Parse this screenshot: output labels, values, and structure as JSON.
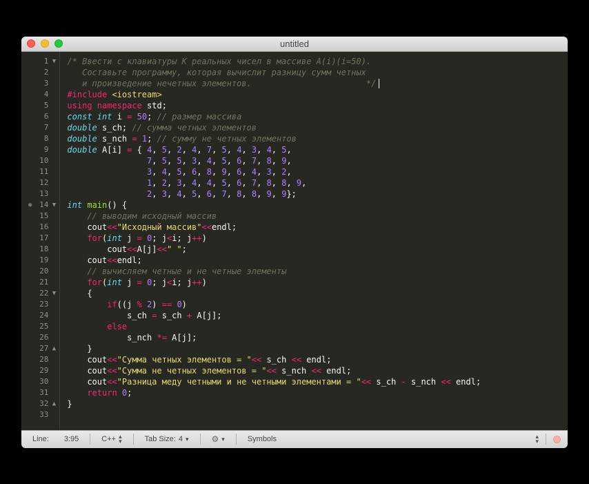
{
  "window": {
    "title": "untitled"
  },
  "status": {
    "line_label": "Line:",
    "line_value": "3:95",
    "language": "C++",
    "tabsize_label": "Tab Size:",
    "tabsize_value": "4",
    "symbols": "Symbols"
  },
  "gutter": [
    {
      "n": "1",
      "mark": "▼"
    },
    {
      "n": "2",
      "mark": ""
    },
    {
      "n": "3",
      "mark": ""
    },
    {
      "n": "4",
      "mark": ""
    },
    {
      "n": "5",
      "mark": ""
    },
    {
      "n": "6",
      "mark": ""
    },
    {
      "n": "7",
      "mark": ""
    },
    {
      "n": "8",
      "mark": ""
    },
    {
      "n": "9",
      "mark": ""
    },
    {
      "n": "10",
      "mark": ""
    },
    {
      "n": "11",
      "mark": ""
    },
    {
      "n": "12",
      "mark": ""
    },
    {
      "n": "13",
      "mark": ""
    },
    {
      "n": "14",
      "mark": "▼",
      "dot": true
    },
    {
      "n": "15",
      "mark": ""
    },
    {
      "n": "16",
      "mark": ""
    },
    {
      "n": "17",
      "mark": ""
    },
    {
      "n": "18",
      "mark": ""
    },
    {
      "n": "19",
      "mark": ""
    },
    {
      "n": "20",
      "mark": ""
    },
    {
      "n": "21",
      "mark": ""
    },
    {
      "n": "22",
      "mark": "▼"
    },
    {
      "n": "23",
      "mark": ""
    },
    {
      "n": "24",
      "mark": ""
    },
    {
      "n": "25",
      "mark": ""
    },
    {
      "n": "26",
      "mark": ""
    },
    {
      "n": "27",
      "mark": "▲"
    },
    {
      "n": "28",
      "mark": ""
    },
    {
      "n": "29",
      "mark": ""
    },
    {
      "n": "30",
      "mark": ""
    },
    {
      "n": "31",
      "mark": ""
    },
    {
      "n": "32",
      "mark": "▲"
    },
    {
      "n": "33",
      "mark": ""
    }
  ],
  "code": [
    [
      {
        "c": "c-comment",
        "t": "/* Ввести с клавиатуры K реальных чисел в массиве A(i)(i=50)."
      }
    ],
    [
      {
        "c": "c-comment",
        "t": "   Составьте программу, которая вычислит разницу сумм четных"
      }
    ],
    [
      {
        "c": "c-comment",
        "t": "   и произведение нечетных элементов.                       */"
      },
      {
        "cursor": true
      }
    ],
    [
      {
        "c": "c-include",
        "t": "#include "
      },
      {
        "c": "c-incfile",
        "t": "<iostream>"
      }
    ],
    [
      {
        "c": "c-keyword2",
        "t": "using"
      },
      {
        "t": " "
      },
      {
        "c": "c-keyword2",
        "t": "namespace"
      },
      {
        "t": " "
      },
      {
        "c": "c-ident",
        "t": "std"
      },
      {
        "c": "c-punct",
        "t": ";"
      }
    ],
    [
      {
        "c": "c-type",
        "t": "const"
      },
      {
        "t": " "
      },
      {
        "c": "c-type",
        "t": "int"
      },
      {
        "t": " "
      },
      {
        "c": "c-ident",
        "t": "i"
      },
      {
        "t": " "
      },
      {
        "c": "c-op",
        "t": "="
      },
      {
        "t": " "
      },
      {
        "c": "c-number",
        "t": "50"
      },
      {
        "c": "c-punct",
        "t": ";"
      },
      {
        "t": " "
      },
      {
        "c": "c-comment",
        "t": "// размер массива"
      }
    ],
    [
      {
        "c": "c-type",
        "t": "double"
      },
      {
        "t": " "
      },
      {
        "c": "c-ident",
        "t": "s_ch"
      },
      {
        "c": "c-punct",
        "t": ";"
      },
      {
        "t": " "
      },
      {
        "c": "c-comment",
        "t": "// сумма четных элементов"
      }
    ],
    [
      {
        "c": "c-type",
        "t": "double"
      },
      {
        "t": " "
      },
      {
        "c": "c-ident",
        "t": "s_nch"
      },
      {
        "t": " "
      },
      {
        "c": "c-op",
        "t": "="
      },
      {
        "t": " "
      },
      {
        "c": "c-number",
        "t": "1"
      },
      {
        "c": "c-punct",
        "t": ";"
      },
      {
        "t": " "
      },
      {
        "c": "c-comment",
        "t": "// сумму не четных элементов"
      }
    ],
    [
      {
        "c": "c-type",
        "t": "double"
      },
      {
        "t": " "
      },
      {
        "c": "c-ident",
        "t": "A"
      },
      {
        "c": "c-punct",
        "t": "["
      },
      {
        "c": "c-ident",
        "t": "i"
      },
      {
        "c": "c-punct",
        "t": "]"
      },
      {
        "t": " "
      },
      {
        "c": "c-op",
        "t": "="
      },
      {
        "t": " "
      },
      {
        "c": "c-punct",
        "t": "{ "
      },
      {
        "c": "c-number",
        "t": "4"
      },
      {
        "c": "c-punct",
        "t": ", "
      },
      {
        "c": "c-number",
        "t": "5"
      },
      {
        "c": "c-punct",
        "t": ", "
      },
      {
        "c": "c-number",
        "t": "2"
      },
      {
        "c": "c-punct",
        "t": ", "
      },
      {
        "c": "c-number",
        "t": "4"
      },
      {
        "c": "c-punct",
        "t": ", "
      },
      {
        "c": "c-number",
        "t": "7"
      },
      {
        "c": "c-punct",
        "t": ", "
      },
      {
        "c": "c-number",
        "t": "5"
      },
      {
        "c": "c-punct",
        "t": ", "
      },
      {
        "c": "c-number",
        "t": "4"
      },
      {
        "c": "c-punct",
        "t": ", "
      },
      {
        "c": "c-number",
        "t": "3"
      },
      {
        "c": "c-punct",
        "t": ", "
      },
      {
        "c": "c-number",
        "t": "4"
      },
      {
        "c": "c-punct",
        "t": ", "
      },
      {
        "c": "c-number",
        "t": "5"
      },
      {
        "c": "c-punct",
        "t": ","
      }
    ],
    [
      {
        "t": "                "
      },
      {
        "c": "c-number",
        "t": "7"
      },
      {
        "c": "c-punct",
        "t": ", "
      },
      {
        "c": "c-number",
        "t": "5"
      },
      {
        "c": "c-punct",
        "t": ", "
      },
      {
        "c": "c-number",
        "t": "5"
      },
      {
        "c": "c-punct",
        "t": ", "
      },
      {
        "c": "c-number",
        "t": "3"
      },
      {
        "c": "c-punct",
        "t": ", "
      },
      {
        "c": "c-number",
        "t": "4"
      },
      {
        "c": "c-punct",
        "t": ", "
      },
      {
        "c": "c-number",
        "t": "5"
      },
      {
        "c": "c-punct",
        "t": ", "
      },
      {
        "c": "c-number",
        "t": "6"
      },
      {
        "c": "c-punct",
        "t": ", "
      },
      {
        "c": "c-number",
        "t": "7"
      },
      {
        "c": "c-punct",
        "t": ", "
      },
      {
        "c": "c-number",
        "t": "8"
      },
      {
        "c": "c-punct",
        "t": ", "
      },
      {
        "c": "c-number",
        "t": "9"
      },
      {
        "c": "c-punct",
        "t": ","
      }
    ],
    [
      {
        "t": "                "
      },
      {
        "c": "c-number",
        "t": "3"
      },
      {
        "c": "c-punct",
        "t": ", "
      },
      {
        "c": "c-number",
        "t": "4"
      },
      {
        "c": "c-punct",
        "t": ", "
      },
      {
        "c": "c-number",
        "t": "5"
      },
      {
        "c": "c-punct",
        "t": ", "
      },
      {
        "c": "c-number",
        "t": "6"
      },
      {
        "c": "c-punct",
        "t": ", "
      },
      {
        "c": "c-number",
        "t": "8"
      },
      {
        "c": "c-punct",
        "t": ", "
      },
      {
        "c": "c-number",
        "t": "9"
      },
      {
        "c": "c-punct",
        "t": ", "
      },
      {
        "c": "c-number",
        "t": "6"
      },
      {
        "c": "c-punct",
        "t": ", "
      },
      {
        "c": "c-number",
        "t": "4"
      },
      {
        "c": "c-punct",
        "t": ", "
      },
      {
        "c": "c-number",
        "t": "3"
      },
      {
        "c": "c-punct",
        "t": ", "
      },
      {
        "c": "c-number",
        "t": "2"
      },
      {
        "c": "c-punct",
        "t": ","
      }
    ],
    [
      {
        "t": "                "
      },
      {
        "c": "c-number",
        "t": "1"
      },
      {
        "c": "c-punct",
        "t": ", "
      },
      {
        "c": "c-number",
        "t": "2"
      },
      {
        "c": "c-punct",
        "t": ", "
      },
      {
        "c": "c-number",
        "t": "3"
      },
      {
        "c": "c-punct",
        "t": ", "
      },
      {
        "c": "c-number",
        "t": "4"
      },
      {
        "c": "c-punct",
        "t": ", "
      },
      {
        "c": "c-number",
        "t": "4"
      },
      {
        "c": "c-punct",
        "t": ", "
      },
      {
        "c": "c-number",
        "t": "5"
      },
      {
        "c": "c-punct",
        "t": ", "
      },
      {
        "c": "c-number",
        "t": "6"
      },
      {
        "c": "c-punct",
        "t": ", "
      },
      {
        "c": "c-number",
        "t": "7"
      },
      {
        "c": "c-punct",
        "t": ", "
      },
      {
        "c": "c-number",
        "t": "8"
      },
      {
        "c": "c-punct",
        "t": ", "
      },
      {
        "c": "c-number",
        "t": "8"
      },
      {
        "c": "c-punct",
        "t": ", "
      },
      {
        "c": "c-number",
        "t": "9"
      },
      {
        "c": "c-punct",
        "t": ","
      }
    ],
    [
      {
        "t": "                "
      },
      {
        "c": "c-number",
        "t": "2"
      },
      {
        "c": "c-punct",
        "t": ", "
      },
      {
        "c": "c-number",
        "t": "3"
      },
      {
        "c": "c-punct",
        "t": ", "
      },
      {
        "c": "c-number",
        "t": "4"
      },
      {
        "c": "c-punct",
        "t": ", "
      },
      {
        "c": "c-number",
        "t": "5"
      },
      {
        "c": "c-punct",
        "t": ", "
      },
      {
        "c": "c-number",
        "t": "6"
      },
      {
        "c": "c-punct",
        "t": ", "
      },
      {
        "c": "c-number",
        "t": "7"
      },
      {
        "c": "c-punct",
        "t": ", "
      },
      {
        "c": "c-number",
        "t": "8"
      },
      {
        "c": "c-punct",
        "t": ", "
      },
      {
        "c": "c-number",
        "t": "8"
      },
      {
        "c": "c-punct",
        "t": ", "
      },
      {
        "c": "c-number",
        "t": "9"
      },
      {
        "c": "c-punct",
        "t": ", "
      },
      {
        "c": "c-number",
        "t": "9"
      },
      {
        "c": "c-punct",
        "t": "};"
      }
    ],
    [
      {
        "c": "c-type",
        "t": "int"
      },
      {
        "t": " "
      },
      {
        "c": "c-func",
        "t": "main"
      },
      {
        "c": "c-punct",
        "t": "() {"
      }
    ],
    [
      {
        "t": "    "
      },
      {
        "c": "c-comment",
        "t": "// выводим исходный массив"
      }
    ],
    [
      {
        "t": "    "
      },
      {
        "c": "c-ident",
        "t": "cout"
      },
      {
        "c": "c-op",
        "t": "<<"
      },
      {
        "c": "c-string",
        "t": "\"Исходный массив\""
      },
      {
        "c": "c-op",
        "t": "<<"
      },
      {
        "c": "c-ident",
        "t": "endl"
      },
      {
        "c": "c-punct",
        "t": ";"
      }
    ],
    [
      {
        "t": "    "
      },
      {
        "c": "c-keyword2",
        "t": "for"
      },
      {
        "c": "c-punct",
        "t": "("
      },
      {
        "c": "c-type",
        "t": "int"
      },
      {
        "t": " "
      },
      {
        "c": "c-ident",
        "t": "j"
      },
      {
        "t": " "
      },
      {
        "c": "c-op",
        "t": "="
      },
      {
        "t": " "
      },
      {
        "c": "c-number",
        "t": "0"
      },
      {
        "c": "c-punct",
        "t": "; "
      },
      {
        "c": "c-ident",
        "t": "j"
      },
      {
        "c": "c-op",
        "t": "<"
      },
      {
        "c": "c-ident",
        "t": "i"
      },
      {
        "c": "c-punct",
        "t": "; "
      },
      {
        "c": "c-ident",
        "t": "j"
      },
      {
        "c": "c-op",
        "t": "++"
      },
      {
        "c": "c-punct",
        "t": ")"
      }
    ],
    [
      {
        "t": "        "
      },
      {
        "c": "c-ident",
        "t": "cout"
      },
      {
        "c": "c-op",
        "t": "<<"
      },
      {
        "c": "c-ident",
        "t": "A"
      },
      {
        "c": "c-punct",
        "t": "["
      },
      {
        "c": "c-ident",
        "t": "j"
      },
      {
        "c": "c-punct",
        "t": "]"
      },
      {
        "c": "c-op",
        "t": "<<"
      },
      {
        "c": "c-string",
        "t": "\" \""
      },
      {
        "c": "c-punct",
        "t": ";"
      }
    ],
    [
      {
        "t": "    "
      },
      {
        "c": "c-ident",
        "t": "cout"
      },
      {
        "c": "c-op",
        "t": "<<"
      },
      {
        "c": "c-ident",
        "t": "endl"
      },
      {
        "c": "c-punct",
        "t": ";"
      }
    ],
    [
      {
        "t": "    "
      },
      {
        "c": "c-comment",
        "t": "// вычисляем четные и не четные элементы"
      }
    ],
    [
      {
        "t": "    "
      },
      {
        "c": "c-keyword2",
        "t": "for"
      },
      {
        "c": "c-punct",
        "t": "("
      },
      {
        "c": "c-type",
        "t": "int"
      },
      {
        "t": " "
      },
      {
        "c": "c-ident",
        "t": "j"
      },
      {
        "t": " "
      },
      {
        "c": "c-op",
        "t": "="
      },
      {
        "t": " "
      },
      {
        "c": "c-number",
        "t": "0"
      },
      {
        "c": "c-punct",
        "t": "; "
      },
      {
        "c": "c-ident",
        "t": "j"
      },
      {
        "c": "c-op",
        "t": "<"
      },
      {
        "c": "c-ident",
        "t": "i"
      },
      {
        "c": "c-punct",
        "t": "; "
      },
      {
        "c": "c-ident",
        "t": "j"
      },
      {
        "c": "c-op",
        "t": "++"
      },
      {
        "c": "c-punct",
        "t": ")"
      }
    ],
    [
      {
        "t": "    "
      },
      {
        "c": "c-punct",
        "t": "{"
      }
    ],
    [
      {
        "t": "        "
      },
      {
        "c": "c-keyword2",
        "t": "if"
      },
      {
        "c": "c-punct",
        "t": "(("
      },
      {
        "c": "c-ident",
        "t": "j"
      },
      {
        "t": " "
      },
      {
        "c": "c-op",
        "t": "%"
      },
      {
        "t": " "
      },
      {
        "c": "c-number",
        "t": "2"
      },
      {
        "c": "c-punct",
        "t": ") "
      },
      {
        "c": "c-op",
        "t": "=="
      },
      {
        "t": " "
      },
      {
        "c": "c-number",
        "t": "0"
      },
      {
        "c": "c-punct",
        "t": ")"
      }
    ],
    [
      {
        "t": "            "
      },
      {
        "c": "c-ident",
        "t": "s_ch"
      },
      {
        "t": " "
      },
      {
        "c": "c-op",
        "t": "="
      },
      {
        "t": " "
      },
      {
        "c": "c-ident",
        "t": "s_ch"
      },
      {
        "t": " "
      },
      {
        "c": "c-op",
        "t": "+"
      },
      {
        "t": " "
      },
      {
        "c": "c-ident",
        "t": "A"
      },
      {
        "c": "c-punct",
        "t": "["
      },
      {
        "c": "c-ident",
        "t": "j"
      },
      {
        "c": "c-punct",
        "t": "];"
      }
    ],
    [
      {
        "t": "        "
      },
      {
        "c": "c-keyword2",
        "t": "else"
      }
    ],
    [
      {
        "t": "            "
      },
      {
        "c": "c-ident",
        "t": "s_nch"
      },
      {
        "t": " "
      },
      {
        "c": "c-op",
        "t": "*="
      },
      {
        "t": " "
      },
      {
        "c": "c-ident",
        "t": "A"
      },
      {
        "c": "c-punct",
        "t": "["
      },
      {
        "c": "c-ident",
        "t": "j"
      },
      {
        "c": "c-punct",
        "t": "];"
      }
    ],
    [
      {
        "t": "    "
      },
      {
        "c": "c-punct",
        "t": "}"
      }
    ],
    [
      {
        "t": "    "
      },
      {
        "c": "c-ident",
        "t": "cout"
      },
      {
        "c": "c-op",
        "t": "<<"
      },
      {
        "c": "c-string",
        "t": "\"Сумма четных элементов = \""
      },
      {
        "c": "c-op",
        "t": "<<"
      },
      {
        "t": " "
      },
      {
        "c": "c-ident",
        "t": "s_ch"
      },
      {
        "t": " "
      },
      {
        "c": "c-op",
        "t": "<<"
      },
      {
        "t": " "
      },
      {
        "c": "c-ident",
        "t": "endl"
      },
      {
        "c": "c-punct",
        "t": ";"
      }
    ],
    [
      {
        "t": "    "
      },
      {
        "c": "c-ident",
        "t": "cout"
      },
      {
        "c": "c-op",
        "t": "<<"
      },
      {
        "c": "c-string",
        "t": "\"Сумма не четных элементов = \""
      },
      {
        "c": "c-op",
        "t": "<<"
      },
      {
        "t": " "
      },
      {
        "c": "c-ident",
        "t": "s_nch"
      },
      {
        "t": " "
      },
      {
        "c": "c-op",
        "t": "<<"
      },
      {
        "t": " "
      },
      {
        "c": "c-ident",
        "t": "endl"
      },
      {
        "c": "c-punct",
        "t": ";"
      }
    ],
    [
      {
        "t": "    "
      },
      {
        "c": "c-ident",
        "t": "cout"
      },
      {
        "c": "c-op",
        "t": "<<"
      },
      {
        "c": "c-string",
        "t": "\"Разница меду четными и не четными элементами = \""
      },
      {
        "c": "c-op",
        "t": "<<"
      },
      {
        "t": " "
      },
      {
        "c": "c-ident",
        "t": "s_ch"
      },
      {
        "t": " "
      },
      {
        "c": "c-op",
        "t": "-"
      },
      {
        "t": " "
      },
      {
        "c": "c-ident",
        "t": "s_nch"
      },
      {
        "t": " "
      },
      {
        "c": "c-op",
        "t": "<<"
      },
      {
        "t": " "
      },
      {
        "c": "c-ident",
        "t": "endl"
      },
      {
        "c": "c-punct",
        "t": ";"
      }
    ],
    [
      {
        "t": "    "
      },
      {
        "c": "c-keyword2",
        "t": "return"
      },
      {
        "t": " "
      },
      {
        "c": "c-number",
        "t": "0"
      },
      {
        "c": "c-punct",
        "t": ";"
      }
    ],
    [
      {
        "c": "c-punct",
        "t": "}"
      }
    ],
    [
      {
        "t": ""
      }
    ]
  ]
}
